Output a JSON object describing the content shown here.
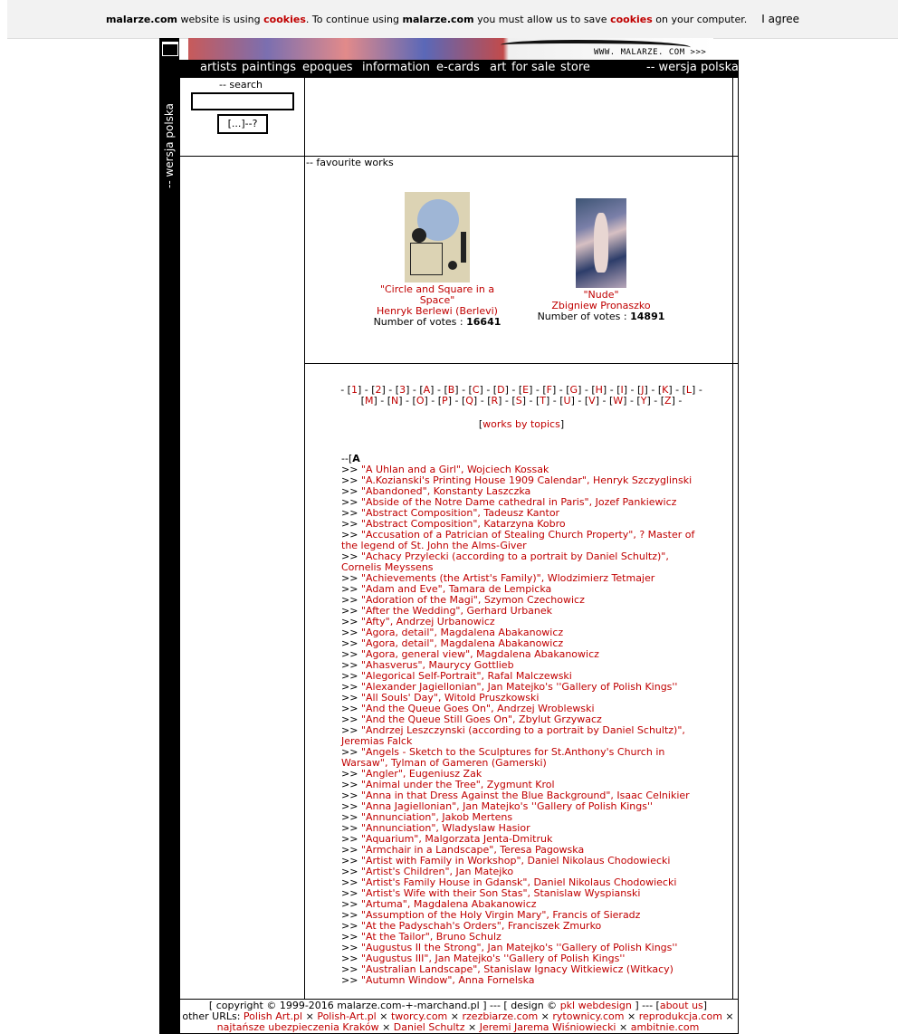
{
  "cookie": {
    "site1": "malarze.com",
    "text1": " website is using ",
    "link1": "cookies",
    "text2": ". To continue using ",
    "site2": "malarze.com",
    "text3": " you must allow us to save ",
    "link2": "cookies",
    "text4": " on your computer.",
    "agree": "I agree"
  },
  "side": {
    "label": "-- wersja polska"
  },
  "banner": {
    "url": "WWW. MALARZE. COM >>>"
  },
  "nav": {
    "items": [
      "artists",
      "paintings",
      "epoques",
      "information",
      "e-cards",
      "art",
      "for sale",
      "store"
    ],
    "lang": "-- wersja polska"
  },
  "search": {
    "label": "-- search",
    "button": "[...]--?"
  },
  "favourites": {
    "title": "-- favourite works",
    "works": [
      {
        "title": "\"Circle and Square in a Space\"",
        "artist": "Henryk Berlewi (Berlevi)",
        "votes_label": "Number of votes : ",
        "votes": "16641"
      },
      {
        "title": "\"Nude\"",
        "artist": "Zbigniew Pronaszko",
        "votes_label": "Number of votes : ",
        "votes": "14891"
      }
    ]
  },
  "letters": {
    "line1": [
      "1",
      "2",
      "3",
      "A",
      "B",
      "C",
      "D",
      "E",
      "F",
      "G",
      "H",
      "I",
      "J",
      "K",
      "L"
    ],
    "line2": [
      "M",
      "N",
      "O",
      "P",
      "Q",
      "R",
      "S",
      "T",
      "U",
      "V",
      "W",
      "Y",
      "Z"
    ]
  },
  "topics": "works by topics",
  "list": {
    "head_prefix": "--[",
    "head_letter": "A",
    "marker": ">> ",
    "items": [
      "\"A Uhlan and a Girl\", Wojciech Kossak",
      "\"A.Kozianski's Printing House 1909 Calendar\", Henryk Szczyglinski",
      "\"Abandoned\", Konstanty Laszczka",
      "\"Abside of the Notre Dame cathedral in Paris\", Jozef Pankiewicz",
      "\"Abstract Composition\", Tadeusz Kantor",
      "\"Abstract Composition\", Katarzyna Kobro",
      "\"Accusation of a Patrician of Stealing Church Property\", ? Master of the legend of St. John the Alms-Giver",
      "\"Achacy Przylecki (according to a portrait by Daniel Schultz)\", Cornelis Meyssens",
      "\"Achievements (the Artist's Family)\", Wlodzimierz Tetmajer",
      "\"Adam and Eve\", Tamara de Lempicka",
      "\"Adoration of the Magi\", Szymon Czechowicz",
      "\"After the Wedding\", Gerhard Urbanek",
      "\"Afty\", Andrzej Urbanowicz",
      "\"Agora, detail\", Magdalena Abakanowicz",
      "\"Agora, detail\", Magdalena Abakanowicz",
      "\"Agora, general view\", Magdalena Abakanowicz",
      "\"Ahasverus\", Maurycy Gottlieb",
      "\"Alegorical Self-Portrait\", Rafal Malczewski",
      "\"Alexander Jagiellonian\", Jan Matejko's ''Gallery of Polish Kings''",
      "\"All Souls' Day\", Witold Pruszkowski",
      "\"And the Queue Goes On\", Andrzej Wroblewski",
      "\"And the Queue Still Goes On\", Zbylut Grzywacz",
      "\"Andrzej Leszczynski (according to a portrait by Daniel Schultz)\", Jeremias Falck",
      "\"Angels - Sketch to the Sculptures for St.Anthony's Church in Warsaw\", Tylman of Gameren (Gamerski)",
      "\"Angler\", Eugeniusz Zak",
      "\"Animal under the Tree\", Zygmunt Krol",
      "\"Anna in that Dress Against the Blue Background\", Isaac Celnikier",
      "\"Anna Jagiellonian\", Jan Matejko's ''Gallery of Polish Kings''",
      "\"Annunciation\", Jakob Mertens",
      "\"Annunciation\", Wladyslaw Hasior",
      "\"Aquarium\", Malgorzata Jenta-Dmitruk",
      "\"Armchair in a Landscape\", Teresa Pagowska",
      "\"Artist with Family in Workshop\", Daniel Nikolaus Chodowiecki",
      "\"Artist's Children\", Jan Matejko",
      "\"Artist's Family House in Gdansk\", Daniel Nikolaus Chodowiecki",
      "\"Artist's Wife with their Son Stas\", Stanislaw Wyspianski",
      "\"Artuma\", Magdalena Abakanowicz",
      "\"Assumption of the Holy Virgin Mary\", Francis of Sieradz",
      "\"At the Padyschah's Orders\", Franciszek Zmurko",
      "\"At the Tailor\", Bruno Schulz",
      "\"Augustus II the Strong\", Jan Matejko's ''Gallery of Polish Kings''",
      "\"Augustus III\", Jan Matejko's ''Gallery of Polish Kings''",
      "\"Australian Landscape\", Stanislaw Ignacy Witkiewicz (Witkacy)",
      "\"Autumn Window\", Anna Fornelska"
    ]
  },
  "footer": {
    "copyright": "[ copyright © 1999-2016 malarze.com-+-marchand.pl ] --- [ design © ",
    "design_link": "pkl webdesign",
    "mid": " ] --- [",
    "about": "about us",
    "end": "]",
    "other_label": "other URLs: ",
    "links": [
      "Polish Art.pl",
      "Polish-Art.pl",
      "tworcy.com",
      "rzezbiarze.com",
      "rytownicy.com",
      "reprodukcja.com",
      "najtańsze ubezpieczenia Kraków",
      "Daniel Schultz",
      "Jeremi Jarema Wiśniowiecki",
      "ambitnie.com"
    ]
  }
}
